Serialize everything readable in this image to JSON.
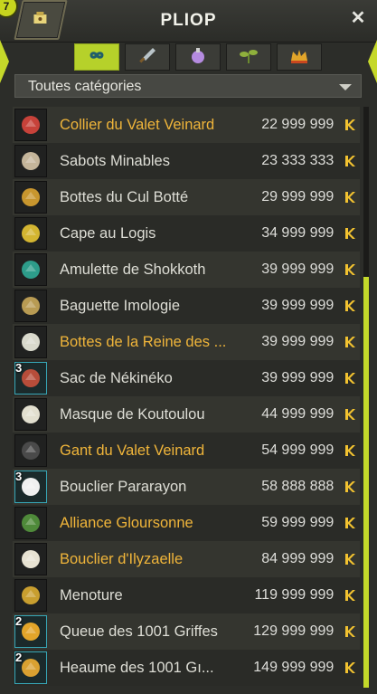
{
  "header": {
    "title": "PLIOP",
    "close_label": "✕",
    "badge_text": "7"
  },
  "tabs": [
    {
      "icon": "infinity-icon",
      "active": true
    },
    {
      "icon": "sword-icon",
      "active": false
    },
    {
      "icon": "potion-icon",
      "active": false
    },
    {
      "icon": "plant-icon",
      "active": false
    },
    {
      "icon": "crown-icon",
      "active": false
    }
  ],
  "filter": {
    "selected": "Toutes catégories"
  },
  "items": [
    {
      "name": "Collier du Valet Veinard",
      "price": "22 999 999",
      "rare": true,
      "qty": "",
      "color": "#c7423a"
    },
    {
      "name": "Sabots Minables",
      "price": "23 333 333",
      "rare": false,
      "qty": "",
      "color": "#c4b59a"
    },
    {
      "name": "Bottes du Cul Botté",
      "price": "29 999 999",
      "rare": false,
      "qty": "",
      "color": "#c8962e"
    },
    {
      "name": "Cape au Logis",
      "price": "34 999 999",
      "rare": false,
      "qty": "",
      "color": "#d3b531"
    },
    {
      "name": "Amulette de Shokkoth",
      "price": "39 999 999",
      "rare": false,
      "qty": "",
      "color": "#2d9c8a"
    },
    {
      "name": "Baguette Imologie",
      "price": "39 999 999",
      "rare": false,
      "qty": "",
      "color": "#b89b53"
    },
    {
      "name": "Bottes de la Reine des ...",
      "price": "39 999 999",
      "rare": true,
      "qty": "",
      "color": "#d9d9cc"
    },
    {
      "name": "Sac de Nékinéko",
      "price": "39 999 999",
      "rare": false,
      "qty": "3",
      "color": "#b74d3a"
    },
    {
      "name": "Masque de Koutoulou",
      "price": "44 999 999",
      "rare": false,
      "qty": "",
      "color": "#e2dfcf"
    },
    {
      "name": "Gant du Valet Veinard",
      "price": "54 999 999",
      "rare": true,
      "qty": "",
      "color": "#4a4a4a"
    },
    {
      "name": "Bouclier Pararayon",
      "price": "58 888 888",
      "rare": false,
      "qty": "3",
      "color": "#f0f0f0"
    },
    {
      "name": "Alliance Gloursonne",
      "price": "59 999 999",
      "rare": true,
      "qty": "",
      "color": "#4f8a3a"
    },
    {
      "name": "Bouclier d'Ilyzaelle",
      "price": "84 999 999",
      "rare": true,
      "qty": "",
      "color": "#e8e3d3"
    },
    {
      "name": "Menoture",
      "price": "119 999 999",
      "rare": false,
      "qty": "",
      "color": "#c89e2f"
    },
    {
      "name": "Queue des 1001 Griffes",
      "price": "129 999 999",
      "rare": false,
      "qty": "2",
      "color": "#e2a52a"
    },
    {
      "name": "Heaume des 1001 Gı...",
      "price": "149 999 999",
      "rare": false,
      "qty": "2",
      "color": "#d9a131"
    }
  ],
  "currency_icon": "kama-icon",
  "colors": {
    "accent": "#c4d92a",
    "rare_text": "#f0b53a",
    "normal_text": "#deded6"
  }
}
